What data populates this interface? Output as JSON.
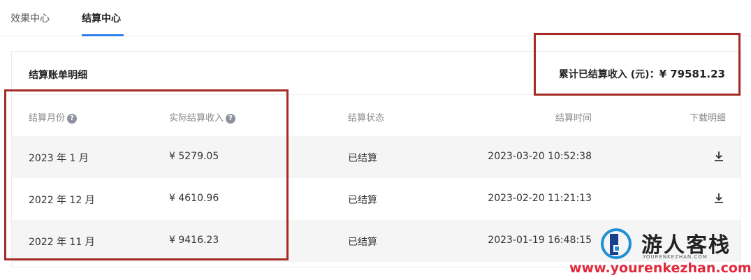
{
  "tabs": [
    {
      "label": "效果中心",
      "active": false
    },
    {
      "label": "结算中心",
      "active": true
    }
  ],
  "card": {
    "title": "结算账单明细",
    "total_label": "累计已结算收入 (元)：",
    "total_value": "¥ 79581.23"
  },
  "table": {
    "headers": {
      "month": "结算月份",
      "income": "实际结算收入",
      "status": "结算状态",
      "time": "结算时间",
      "download": "下载明细"
    },
    "help_icon": "?",
    "rows": [
      {
        "month": "2023 年 1 月",
        "income": "¥ 5279.05",
        "status": "已结算",
        "time": "2023-03-20 10:52:38"
      },
      {
        "month": "2022 年 12 月",
        "income": "¥ 4610.96",
        "status": "已结算",
        "time": "2023-02-20 11:21:13"
      },
      {
        "month": "2022 年 11 月",
        "income": "¥ 9416.23",
        "status": "已结算",
        "time": "2023-01-19 16:48:15"
      }
    ]
  },
  "watermark": {
    "name_cn": "游人客栈",
    "name_en": "YOURENKEZHAN.COM",
    "url": "www.yourenkezhan.com"
  },
  "colors": {
    "accent": "#2f80ed",
    "highlight_box": "#a62b26",
    "watermark_url": "#e02a3c"
  }
}
